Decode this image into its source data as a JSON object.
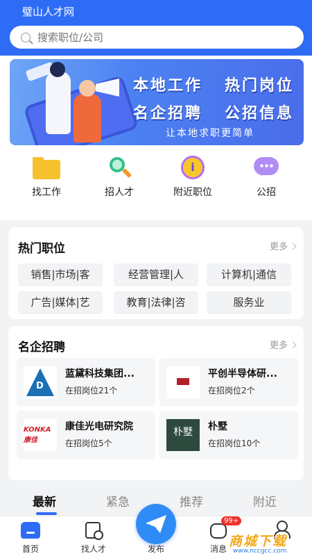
{
  "app": {
    "title": "璧山人才网"
  },
  "search": {
    "placeholder": "搜索职位/公司"
  },
  "banner": {
    "lines": [
      "本地工作",
      "热门岗位",
      "名企招聘",
      "公招信息"
    ],
    "subtitle": "让本地求职更简单"
  },
  "quick_links": [
    {
      "label": "找工作",
      "icon": "folder-icon"
    },
    {
      "label": "招人才",
      "icon": "magnifier-icon"
    },
    {
      "label": "附近职位",
      "icon": "info-icon"
    },
    {
      "label": "公招",
      "icon": "chat-icon"
    }
  ],
  "hot_jobs": {
    "title": "热门职位",
    "more": "更多",
    "tags": [
      "销售|市场|客",
      "经营管理|人",
      "计算机|通信",
      "广告|媒体|艺",
      "教育|法律|咨",
      "服务业"
    ]
  },
  "famous": {
    "title": "名企招聘",
    "more": "更多",
    "companies": [
      {
        "name": "蓝黛科技集团...",
        "count": "在招岗位21个"
      },
      {
        "name": "平创半导体研...",
        "count": "在招岗位2个"
      },
      {
        "name": "康佳光电研究院",
        "count": "在招岗位5个",
        "logo_text": "KONKA康佳"
      },
      {
        "name": "朴墅",
        "count": "在招岗位10个",
        "logo_text": "朴墅"
      }
    ]
  },
  "feed_tabs": [
    "最新",
    "紧急",
    "推荐",
    "附近"
  ],
  "bottom_nav": {
    "items": [
      "首页",
      "找人才",
      "发布",
      "消息"
    ],
    "badge": "99+"
  },
  "watermark": {
    "title": "商城下载",
    "url": "www.nccgcc.com"
  },
  "colors": {
    "primary": "#2f6cf6",
    "badge": "#f0302a"
  }
}
